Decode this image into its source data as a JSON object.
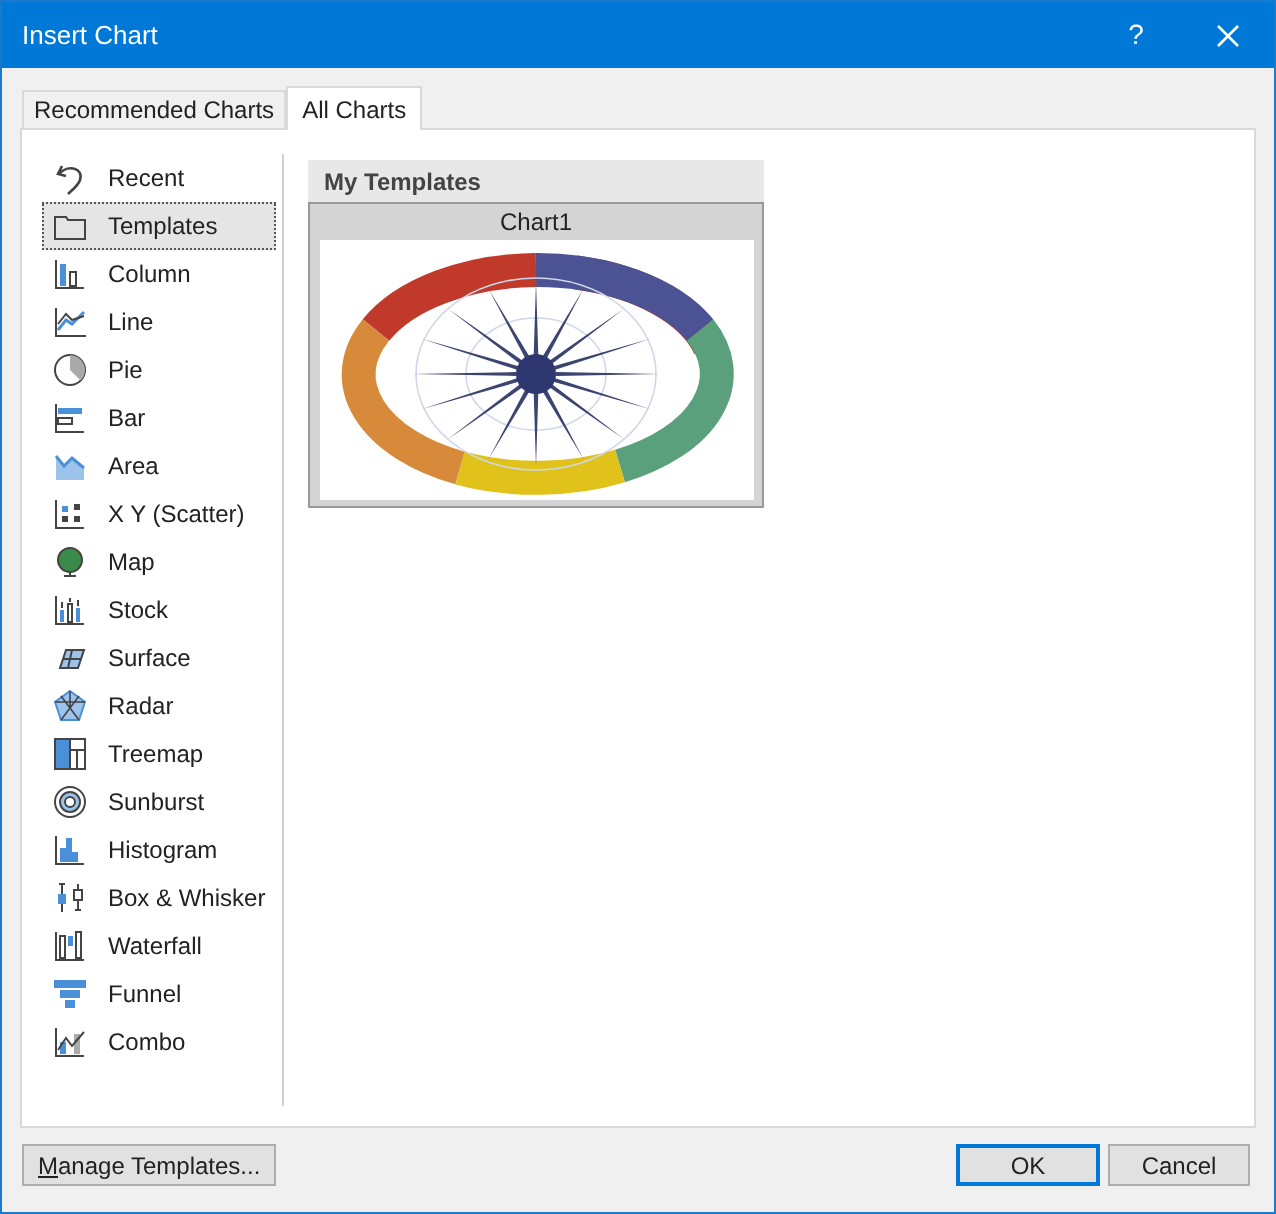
{
  "window": {
    "title": "Insert Chart",
    "help": "?"
  },
  "tabs": [
    {
      "label": "Recommended Charts",
      "selected": false
    },
    {
      "label": "All Charts",
      "selected": true
    }
  ],
  "sidebar": {
    "items": [
      {
        "label": "Recent",
        "selected": false
      },
      {
        "label": "Templates",
        "selected": true
      },
      {
        "label": "Column",
        "selected": false
      },
      {
        "label": "Line",
        "selected": false
      },
      {
        "label": "Pie",
        "selected": false
      },
      {
        "label": "Bar",
        "selected": false
      },
      {
        "label": "Area",
        "selected": false
      },
      {
        "label": "X Y (Scatter)",
        "selected": false
      },
      {
        "label": "Map",
        "selected": false
      },
      {
        "label": "Stock",
        "selected": false
      },
      {
        "label": "Surface",
        "selected": false
      },
      {
        "label": "Radar",
        "selected": false
      },
      {
        "label": "Treemap",
        "selected": false
      },
      {
        "label": "Sunburst",
        "selected": false
      },
      {
        "label": "Histogram",
        "selected": false
      },
      {
        "label": "Box & Whisker",
        "selected": false
      },
      {
        "label": "Waterfall",
        "selected": false
      },
      {
        "label": "Funnel",
        "selected": false
      },
      {
        "label": "Combo",
        "selected": false
      }
    ]
  },
  "templates": {
    "heading": "My Templates",
    "items": [
      {
        "name": "Chart1",
        "kind": "picture"
      }
    ]
  },
  "buttons": {
    "manage": "Manage Templates...",
    "ok": "OK",
    "cancel": "Cancel"
  }
}
